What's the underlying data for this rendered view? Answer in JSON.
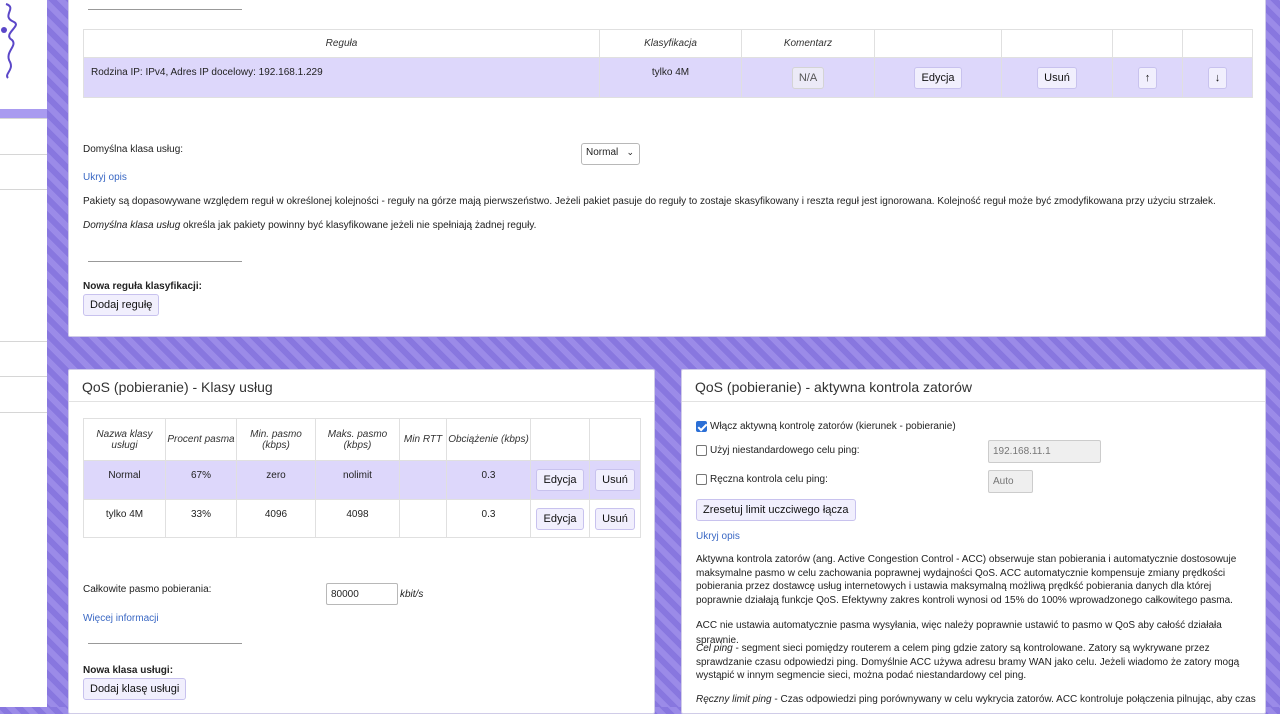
{
  "rules_panel": {
    "table": {
      "headers": [
        "Reguła",
        "Klasyfikacja",
        "Komentarz",
        "",
        "",
        "",
        ""
      ],
      "rows": [
        {
          "rule": "Rodzina IP: IPv4, Adres IP docelowy: 192.168.1.229",
          "class": "tylko 4M",
          "comment": "N/A",
          "edit": "Edycja",
          "delete": "Usuń",
          "up": "↑",
          "down": "↓"
        }
      ]
    },
    "default_class_label": "Domyślna klasa usług:",
    "default_class_value": "Normal",
    "hide_desc_link": "Ukryj opis",
    "desc_1": "Pakiety są dopasowywane względem reguł w określonej kolejności - reguły na górze mają pierwszeństwo. Jeżeli pakiet pasuje do reguły to zostaje skasyfikowany i reszta reguł jest ignorowana. Kolejność reguł może być zmodyfikowana przy użyciu strzałek.",
    "desc_2_em": "Domyślna klasa usług",
    "desc_2_rest": " określa jak pakiety powinny być klasyfikowane jeżeli nie spełniają żadnej reguły.",
    "new_rule_label": "Nowa reguła klasyfikacji:",
    "add_rule_button": "Dodaj regułę"
  },
  "classes_panel": {
    "title": "QoS (pobieranie) - Klasy usług",
    "headers": [
      "Nazwa klasy usługi",
      "Procent pasma",
      "Min. pasmo (kbps)",
      "Maks. pasmo (kbps)",
      "Min RTT",
      "Obciążenie (kbps)",
      "",
      ""
    ],
    "rows": [
      {
        "name": "Normal",
        "percent": "67%",
        "min": "zero",
        "max": "nolimit",
        "rtt": "",
        "load": "0.3",
        "edit": "Edycja",
        "delete": "Usuń"
      },
      {
        "name": "tylko 4M",
        "percent": "33%",
        "min": "4096",
        "max": "4098",
        "rtt": "",
        "load": "0.3",
        "edit": "Edycja",
        "delete": "Usuń"
      }
    ],
    "total_label": "Całkowite pasmo pobierania:",
    "total_value": "80000",
    "total_unit": "kbit/s",
    "more_info_link": "Więcej informacji",
    "new_class_label": "Nowa klasa usługi:",
    "add_class_button": "Dodaj klasę usługi"
  },
  "acc_panel": {
    "title": "QoS (pobieranie) - aktywna kontrola zatorów",
    "enable_label": "Włącz aktywną kontrolę zatorów (kierunek - pobieranie)",
    "enable_checked": true,
    "custom_ping_label": "Użyj niestandardowego celu ping:",
    "custom_ping_checked": false,
    "custom_ping_placeholder": "192.168.11.1",
    "manual_ping_label": "Ręczna kontrola celu ping:",
    "manual_ping_checked": false,
    "manual_ping_placeholder": "Auto",
    "reset_button": "Zresetuj limit uczciwego łącza",
    "hide_desc_link": "Ukryj opis",
    "desc_1": "Aktywna kontrola zatorów (ang. Active Congestion Control - ACC) obserwuje stan pobierania i automatycznie dostosowuje maksymalne pasmo w celu zachowania poprawnej wydajności QoS. ACC automatycznie kompensuje zmiany prędkości pobierania przez dostawcę usług internetowych i ustawia maksymalną możliwą prędkść pobierania danych dla której poprawnie działają funkcje QoS. Efektywny zakres kontroli wynosi od 15% do 100% wprowadzonego całkowitego pasma.",
    "desc_2": "ACC nie ustawia automatycznie pasma wysyłania, więc należy poprawnie ustawić to pasmo w QoS aby całość działała sprawnie.",
    "desc_3_em": "Cel ping",
    "desc_3_rest": " - segment sieci pomiędzy routerem a celem ping gdzie zatory są kontrolowane. Zatory są wykrywane przez sprawdzanie czasu odpowiedzi ping. Domyślnie ACC używa adresu bramy WAN jako celu. Jeżeli wiadomo że zatory mogą wystąpić w innym segmencie sieci, można podać niestandardowy cel ping.",
    "desc_4_em": "Ręczny limit ping",
    "desc_4_rest": " - Czas odpowiedzi ping porównywany w celu wykrycia zatorów. ACC kontroluje połączenia pilnując, aby czas"
  }
}
